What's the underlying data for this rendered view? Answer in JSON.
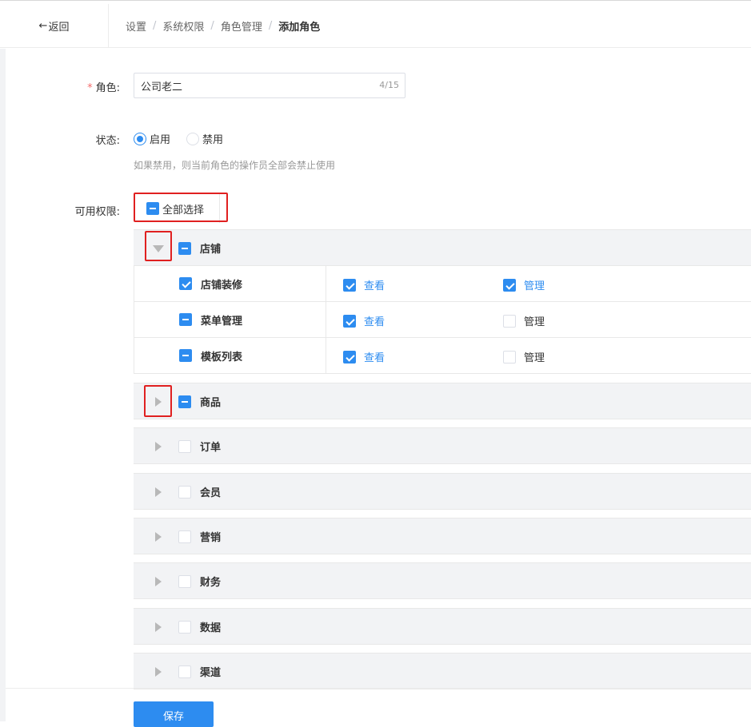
{
  "header": {
    "back_label": "返回",
    "breadcrumb": [
      "设置",
      "系统权限",
      "角色管理",
      "添加角色"
    ]
  },
  "form": {
    "role_label": "角色:",
    "role_value": "公司老二",
    "role_count": "4/15",
    "status_label": "状态:",
    "status_options": [
      "启用",
      "禁用"
    ],
    "status_selected": "启用",
    "status_hint": "如果禁用，则当前角色的操作员全部会禁止使用",
    "perm_label": "可用权限:",
    "select_all_label": "全部选择"
  },
  "permissions": {
    "groups": [
      {
        "name": "店铺",
        "expanded": true,
        "state": "indeterminate",
        "items": [
          {
            "name": "店铺装修",
            "state": "checked",
            "perms": [
              {
                "label": "查看",
                "checked": true
              },
              {
                "label": "管理",
                "checked": true
              }
            ]
          },
          {
            "name": "菜单管理",
            "state": "indeterminate",
            "perms": [
              {
                "label": "查看",
                "checked": true
              },
              {
                "label": "管理",
                "checked": false
              }
            ]
          },
          {
            "name": "模板列表",
            "state": "indeterminate",
            "perms": [
              {
                "label": "查看",
                "checked": true
              },
              {
                "label": "管理",
                "checked": false
              }
            ]
          }
        ]
      },
      {
        "name": "商品",
        "expanded": false,
        "state": "indeterminate"
      },
      {
        "name": "订单",
        "expanded": false,
        "state": "unchecked"
      },
      {
        "name": "会员",
        "expanded": false,
        "state": "unchecked"
      },
      {
        "name": "营销",
        "expanded": false,
        "state": "unchecked"
      },
      {
        "name": "财务",
        "expanded": false,
        "state": "unchecked"
      },
      {
        "name": "数据",
        "expanded": false,
        "state": "unchecked"
      },
      {
        "name": "渠道",
        "expanded": false,
        "state": "unchecked"
      }
    ]
  },
  "actions": {
    "save_label": "保存"
  },
  "colors": {
    "primary": "#2d8cf0",
    "required": "#f56c6c",
    "highlight_box": "#e02020"
  }
}
